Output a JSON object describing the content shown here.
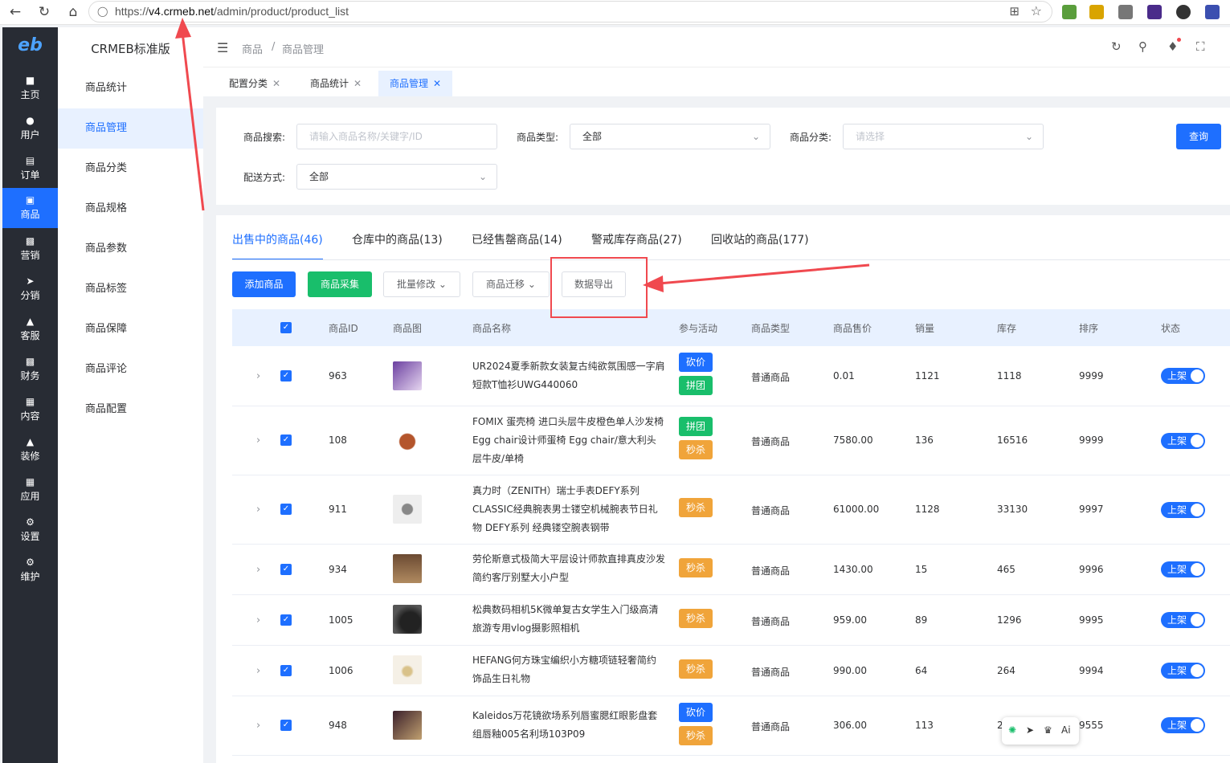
{
  "browser": {
    "url_prefix": "https://",
    "url_domain": "v4.crmeb.net",
    "url_path": "/admin/product/product_list"
  },
  "sidebar": {
    "logo": "eb",
    "items": [
      {
        "label": "主页",
        "icon": "home-icon"
      },
      {
        "label": "用户",
        "icon": "user-icon"
      },
      {
        "label": "订单",
        "icon": "order-icon"
      },
      {
        "label": "商品",
        "icon": "product-icon"
      },
      {
        "label": "营销",
        "icon": "marketing-icon"
      },
      {
        "label": "分销",
        "icon": "distribution-icon"
      },
      {
        "label": "客服",
        "icon": "service-icon"
      },
      {
        "label": "财务",
        "icon": "finance-icon"
      },
      {
        "label": "内容",
        "icon": "content-icon"
      },
      {
        "label": "装修",
        "icon": "decoration-icon"
      },
      {
        "label": "应用",
        "icon": "apps-icon"
      },
      {
        "label": "设置",
        "icon": "settings-icon"
      },
      {
        "label": "维护",
        "icon": "maintenance-icon"
      }
    ],
    "active_index": 3
  },
  "submenu": {
    "title": "CRMEB标准版",
    "items": [
      "商品统计",
      "商品管理",
      "商品分类",
      "商品规格",
      "商品参数",
      "商品标签",
      "商品保障",
      "商品评论",
      "商品配置"
    ],
    "active_index": 1
  },
  "topbar": {
    "breadcrumb": [
      "商品",
      "/",
      "商品管理"
    ]
  },
  "tabs": [
    {
      "label": "配置分类"
    },
    {
      "label": "商品统计"
    },
    {
      "label": "商品管理"
    }
  ],
  "filters": {
    "search_label": "商品搜索:",
    "search_placeholder": "请输入商品名称/关键字/ID",
    "type_label": "商品类型:",
    "type_value": "全部",
    "category_label": "商品分类:",
    "category_placeholder": "请选择",
    "delivery_label": "配送方式:",
    "delivery_value": "全部",
    "query_button": "查询"
  },
  "list_tabs": [
    "出售中的商品(46)",
    "仓库中的商品(13)",
    "已经售罄商品(14)",
    "警戒库存商品(27)",
    "回收站的商品(177)"
  ],
  "actions": {
    "add": "添加商品",
    "collect": "商品采集",
    "batch_edit": "批量修改",
    "migrate": "商品迁移",
    "export": "数据导出"
  },
  "table": {
    "headers": [
      "商品ID",
      "商品图",
      "商品名称",
      "参与活动",
      "商品类型",
      "商品售价",
      "销量",
      "库存",
      "排序",
      "状态"
    ],
    "rows": [
      {
        "id": "963",
        "name": "UR2024夏季新款女装复古纯欲氛围感一字肩短款T恤衫UWG440060",
        "tags": [
          {
            "t": "砍价",
            "c": "blue"
          },
          {
            "t": "拼团",
            "c": "green"
          }
        ],
        "type": "普通商品",
        "price": "0.01",
        "sales": "1121",
        "stock": "1118",
        "sort": "9999",
        "status": "上架"
      },
      {
        "id": "108",
        "name": "FOMIX 蛋壳椅 进口头层牛皮橙色单人沙发椅 Egg chair设计师蛋椅 Egg chair/意大利头层牛皮/单椅",
        "tags": [
          {
            "t": "拼团",
            "c": "green"
          },
          {
            "t": "秒杀",
            "c": "orange"
          }
        ],
        "type": "普通商品",
        "price": "7580.00",
        "sales": "136",
        "stock": "16516",
        "sort": "9999",
        "status": "上架"
      },
      {
        "id": "911",
        "name": "真力时（ZENITH）瑞士手表DEFY系列CLASSIC经典腕表男士镂空机械腕表节日礼物 DEFY系列 经典镂空腕表钢带",
        "tags": [
          {
            "t": "秒杀",
            "c": "orange"
          }
        ],
        "type": "普通商品",
        "price": "61000.00",
        "sales": "1128",
        "stock": "33130",
        "sort": "9997",
        "status": "上架"
      },
      {
        "id": "934",
        "name": "劳伦斯意式极简大平层设计师款直排真皮沙发简约客厅别墅大小户型",
        "tags": [
          {
            "t": "秒杀",
            "c": "orange"
          }
        ],
        "type": "普通商品",
        "price": "1430.00",
        "sales": "15",
        "stock": "465",
        "sort": "9996",
        "status": "上架"
      },
      {
        "id": "1005",
        "name": "松典数码相机5K微单复古女学生入门级高清旅游专用vlog摄影照相机",
        "tags": [
          {
            "t": "秒杀",
            "c": "orange"
          }
        ],
        "type": "普通商品",
        "price": "959.00",
        "sales": "89",
        "stock": "1296",
        "sort": "9995",
        "status": "上架"
      },
      {
        "id": "1006",
        "name": "HEFANG何方珠宝编织小方糖项链轻奢简约饰品生日礼物",
        "tags": [
          {
            "t": "秒杀",
            "c": "orange"
          }
        ],
        "type": "普通商品",
        "price": "990.00",
        "sales": "64",
        "stock": "264",
        "sort": "9994",
        "status": "上架"
      },
      {
        "id": "948",
        "name": "Kaleidos万花镜欲场系列唇蜜腮红眼影盘套组唇釉005名利场103P09",
        "tags": [
          {
            "t": "砍价",
            "c": "blue"
          },
          {
            "t": "秒杀",
            "c": "orange"
          }
        ],
        "type": "普通商品",
        "price": "306.00",
        "sales": "113",
        "stock": "2",
        "sort": "9555",
        "status": "上架"
      }
    ]
  },
  "floatbar": {
    "ai_label": "Ai"
  },
  "colors": {
    "primary": "#1e6fff",
    "success": "#19be6b",
    "warning": "#f0a43a",
    "sidebar_bg": "#282c34",
    "annotation": "#f0494f"
  }
}
